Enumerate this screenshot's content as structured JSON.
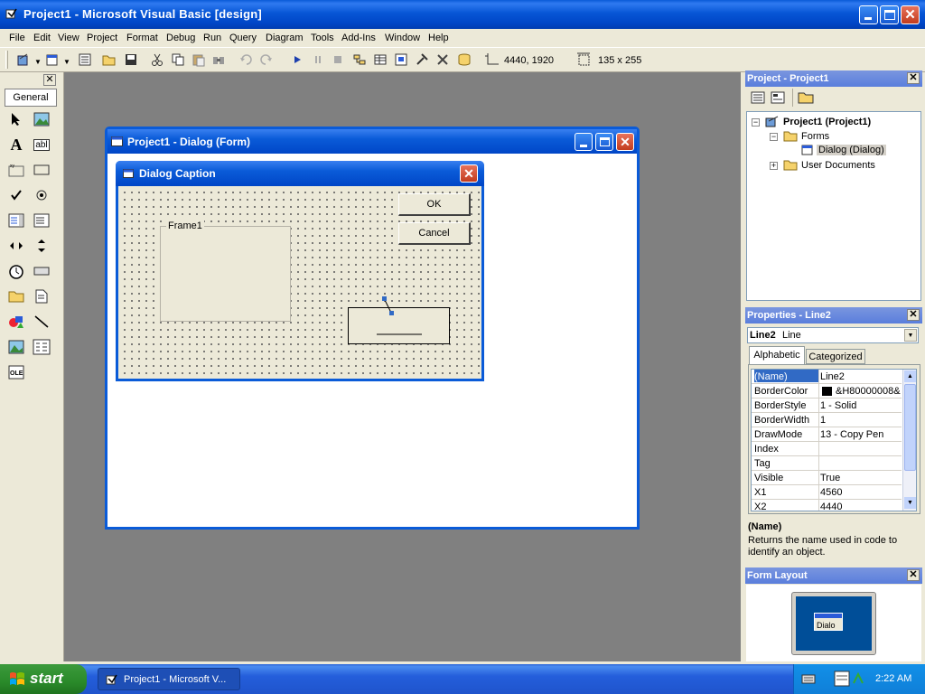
{
  "app": {
    "title": "Project1 - Microsoft Visual Basic [design]"
  },
  "menu": [
    "File",
    "Edit",
    "View",
    "Project",
    "Format",
    "Debug",
    "Run",
    "Query",
    "Diagram",
    "Tools",
    "Add-Ins",
    "Window",
    "Help"
  ],
  "toolbar": {
    "position_readout": "4440, 1920",
    "size_readout": "135 x 255"
  },
  "toolbox": {
    "tab_label": "General"
  },
  "form_window": {
    "title": "Project1 - Dialog (Form)",
    "dialog": {
      "caption": "Dialog Caption",
      "ok_label": "OK",
      "cancel_label": "Cancel",
      "frame_label": "Frame1"
    }
  },
  "project_explorer": {
    "title": "Project - Project1",
    "root": "Project1 (Project1)",
    "forms_label": "Forms",
    "form_item": "Dialog (Dialog)",
    "user_docs": "User Documents"
  },
  "properties": {
    "title": "Properties - Line2",
    "object_name": "Line2",
    "object_type": "Line",
    "tab_alphabetic": "Alphabetic",
    "tab_categorized": "Categorized",
    "rows": [
      {
        "name": "(Name)",
        "value": "Line2"
      },
      {
        "name": "BorderColor",
        "value": "&H80000008&"
      },
      {
        "name": "BorderStyle",
        "value": "1 - Solid"
      },
      {
        "name": "BorderWidth",
        "value": "1"
      },
      {
        "name": "DrawMode",
        "value": "13 - Copy Pen"
      },
      {
        "name": "Index",
        "value": ""
      },
      {
        "name": "Tag",
        "value": ""
      },
      {
        "name": "Visible",
        "value": "True"
      },
      {
        "name": "X1",
        "value": "4560"
      },
      {
        "name": "X2",
        "value": "4440"
      }
    ],
    "desc_title": "(Name)",
    "desc_text": "Returns the name used in code to identify an object."
  },
  "form_layout": {
    "title": "Form Layout",
    "preview_label": "Dialo"
  },
  "taskbar": {
    "start_label": "start",
    "task_label": "Project1 - Microsoft V...",
    "clock": "2:22 AM"
  },
  "colors": {
    "titlebar": "#0054e3",
    "workspace": "#808080",
    "selection": "#316ac5",
    "taskbar": "#245edb",
    "start": "#3c9a3c"
  }
}
